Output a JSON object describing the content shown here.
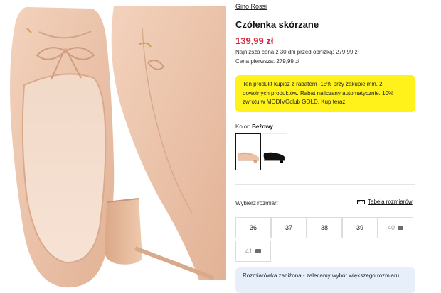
{
  "product": {
    "brand": "Gino Rossi",
    "title": "Czółenka skórzane",
    "price": "139,99 zł",
    "lowest_price_label": "Najniższa cena z 30 dni przed obniżką:",
    "lowest_price_value": "279,99 zł",
    "first_price_label": "Cena pierwsza:",
    "first_price_value": "279,99 zł"
  },
  "promo": {
    "text": "Ten produkt kupisz z rabatem -15% przy zakupie min. 2 dowolnych produktów. Rabat naliczany automatycznie. 10% zwrotu w MODIVOclub GOLD. Kup teraz!",
    "color": "#fff21a"
  },
  "color": {
    "label": "Kolor:",
    "value": "Beżowy",
    "swatches": [
      {
        "name": "Beżowy",
        "selected": true,
        "color": "#ecc3a7"
      },
      {
        "name": "Czarny",
        "selected": false,
        "color": "#111111"
      }
    ]
  },
  "size": {
    "label": "Wybierz rozmiar:",
    "chart_link": "Tabela rozmiarów",
    "chart_icon": "ruler-icon",
    "options": [
      {
        "label": "36",
        "available": true
      },
      {
        "label": "37",
        "available": true
      },
      {
        "label": "38",
        "available": true
      },
      {
        "label": "39",
        "available": true
      },
      {
        "label": "40",
        "available": false
      },
      {
        "label": "41",
        "available": false
      }
    ],
    "unavailable_icon": "envelope-icon"
  },
  "notice": {
    "text": "Rozmiarówka zaniżona - zalecamy wybór większego rozmiaru",
    "color": "#e7effb"
  },
  "colors": {
    "price": "#d9253c",
    "shoe_leather": "#ecc3a7"
  }
}
